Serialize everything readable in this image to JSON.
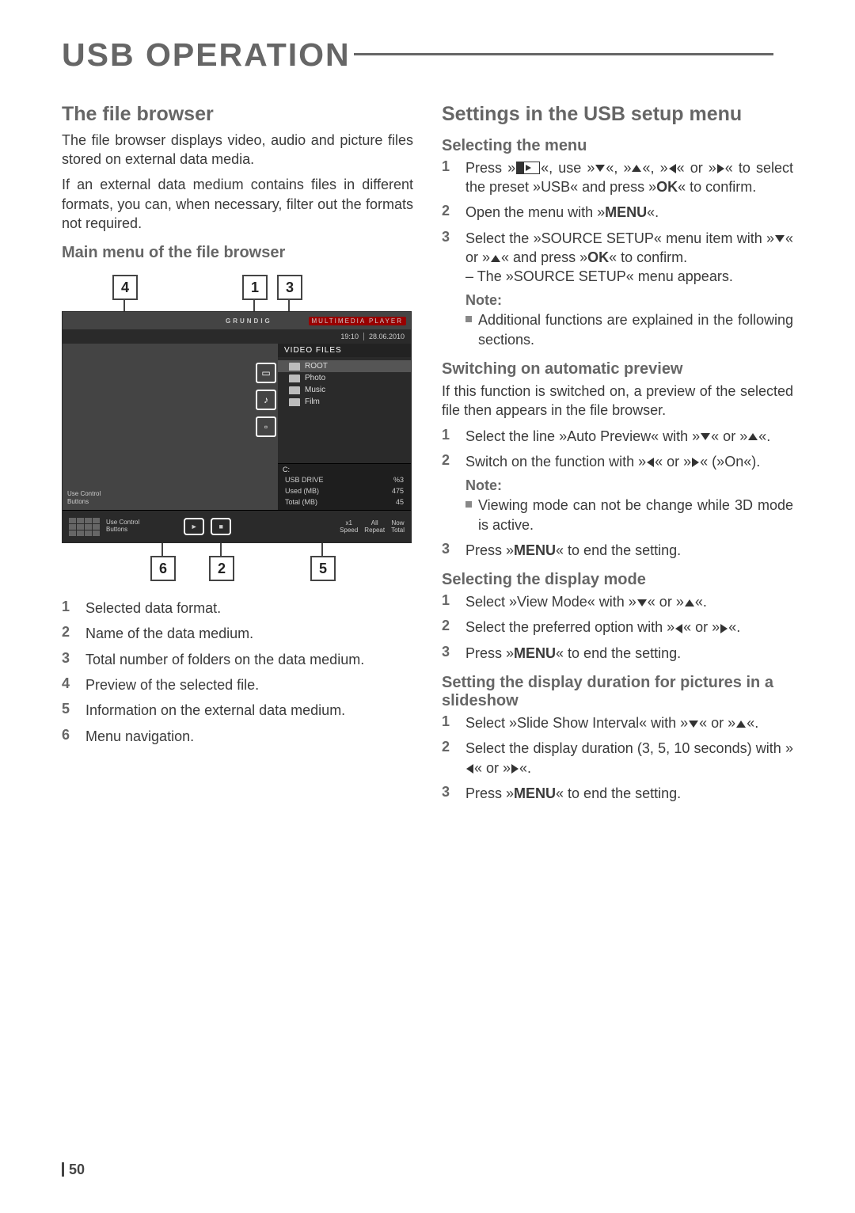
{
  "chapter": "USB OPERATION",
  "page_number": "50",
  "left": {
    "h_file_browser": "The file browser",
    "p1": "The file browser displays video, audio and picture files stored on external data media.",
    "p2": "If an external data medium contains files in different formats, you can, when necessary, filter out the formats not required.",
    "h_main_menu": "Main menu of the file browser",
    "callouts": {
      "c1": "1",
      "c2": "2",
      "c3": "3",
      "c4": "4",
      "c5": "5",
      "c6": "6"
    },
    "screenshot": {
      "brand": "GRUNDIG",
      "player_label": "MULTIMEDIA PLAYER",
      "time": "19:10",
      "date": "28.06.2010",
      "list_header": "VIDEO FILES",
      "rows": {
        "root": "ROOT",
        "photo": "Photo",
        "music": "Music",
        "film": "Film"
      },
      "drive_label": "C:",
      "drive_name": "USB DRIVE",
      "drive_pct": "%3",
      "used_label": "Used (MB)",
      "used_val": "475",
      "total_label": "Total (MB)",
      "total_val": "45",
      "ctrl1": "Use Control",
      "ctrl2": "Buttons",
      "speed_v": "x1",
      "speed_l": "Speed",
      "repeat_v": "All",
      "repeat_l": "Repeat",
      "now_v": "Now",
      "now_l": "Total"
    },
    "legend": {
      "l1": "Selected data format.",
      "l2": "Name of the data medium.",
      "l3": "Total number of folders on the data medium.",
      "l4": "Preview of the selected file.",
      "l5": "Information on the external data medium.",
      "l6": "Menu navigation."
    }
  },
  "right": {
    "h_settings": "Settings in the USB setup menu",
    "h_select_menu": "Selecting the menu",
    "sm": {
      "s1a": "Press »",
      "s1b": "«, use »",
      "s1c": "«, »",
      "s1d": "«, »",
      "s1e": "« or »",
      "s1f": "« to select the preset »USB« and press »",
      "s1_ok": "OK",
      "s1g": "« to confirm.",
      "s2a": "Open the menu with »",
      "s2_menu": "MENU",
      "s2b": "«.",
      "s3a": "Select the »SOURCE SETUP« menu item with »",
      "s3b": "« or »",
      "s3c": "« and press »",
      "s3_ok": "OK",
      "s3d": "« to confirm.",
      "s3_sub": "The »SOURCE SETUP« menu appears."
    },
    "note1_label": "Note:",
    "note1_text": "Additional functions are explained in the following sections.",
    "h_autoprev": "Switching on automatic preview",
    "ap_intro": "If this function is switched on, a preview of the selected file then appears in the file browser.",
    "ap": {
      "s1a": "Select the line »Auto Preview« with »",
      "s1b": "« or »",
      "s1c": "«.",
      "s2a": "Switch on the function with »",
      "s2b": "« or »",
      "s2c": "« (»On«).",
      "s3a": "Press »",
      "s3_menu": "MENU",
      "s3b": "« to end the setting."
    },
    "note2_label": "Note:",
    "note2_text": "Viewing mode can not be change while 3D mode is active.",
    "h_display": "Selecting the display mode",
    "dm": {
      "s1a": "Select »View Mode« with »",
      "s1b": "« or »",
      "s1c": "«.",
      "s2a": "Select the preferred option with »",
      "s2b": "« or »",
      "s2c": "«.",
      "s3a": "Press »",
      "s3_menu": "MENU",
      "s3b": "« to end the setting."
    },
    "h_slide": "Setting the display duration for pictures in a slideshow",
    "ss": {
      "s1a": "Select »Slide Show Interval« with »",
      "s1b": "« or »",
      "s1c": "«.",
      "s2": "Select the display duration (3, 5, 10 seconds) with »",
      "s2b": "« or »",
      "s2c": "«.",
      "s3a": "Press »",
      "s3_menu": "MENU",
      "s3b": "« to end the setting."
    }
  }
}
